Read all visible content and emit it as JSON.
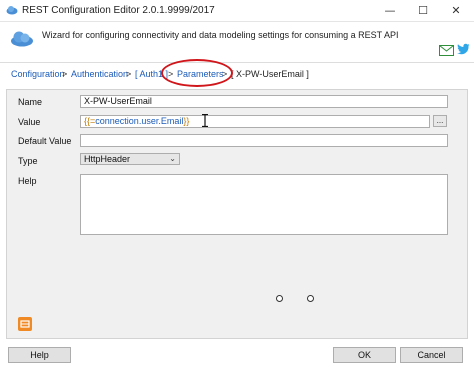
{
  "window": {
    "title": "REST Configuration Editor 2.0.1.9999/2017",
    "minimize_glyph": "—",
    "maximize_glyph": "☐",
    "close_glyph": "✕"
  },
  "header": {
    "description": "Wizard for configuring connectivity and data modeling settings for consuming a REST API",
    "icons": [
      "cloud-icon",
      "mail-icon",
      "twitter-icon"
    ]
  },
  "breadcrumb": {
    "items": [
      {
        "label": "Configuration"
      },
      {
        "label": "Authentication"
      },
      {
        "label": "[ Auth1 ]"
      },
      {
        "label": "Parameters"
      },
      {
        "label": "[ X-PW-UserEmail ]"
      }
    ],
    "separator": ">"
  },
  "form": {
    "name_label": "Name",
    "name_value": "X-PW-UserEmail",
    "value_label": "Value",
    "value_open": "{{=",
    "value_expr": "connection.user.Email",
    "value_close": "}}",
    "value_button": "...",
    "default_label": "Default Value",
    "default_value": "",
    "type_label": "Type",
    "type_value": "HttpHeader",
    "help_label": "Help",
    "help_value": ""
  },
  "footer": {
    "help_button": "Help",
    "ok_button": "OK",
    "cancel_button": "Cancel"
  },
  "colors": {
    "link": "#1c5bb8",
    "highlight": "#d0161b",
    "accent_orange": "#f08a24"
  }
}
